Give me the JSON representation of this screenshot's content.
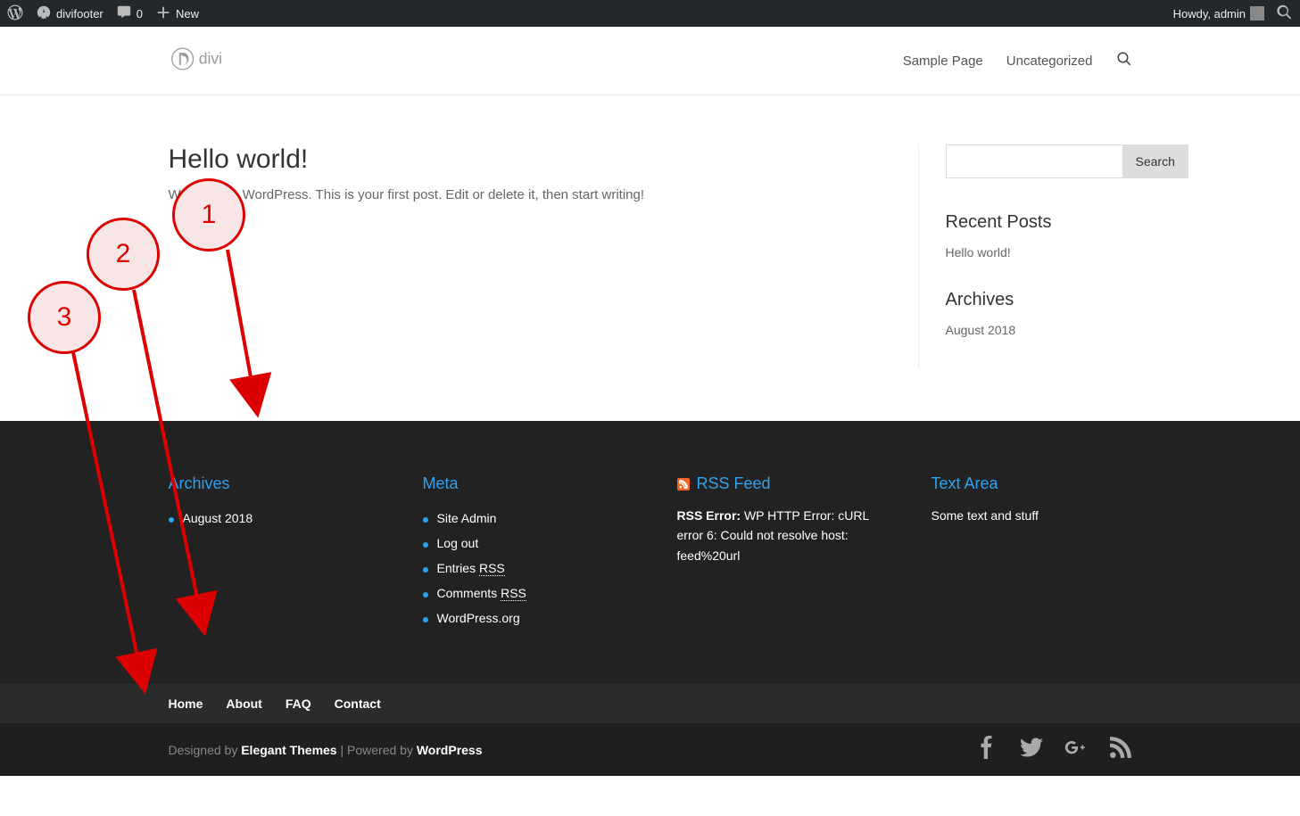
{
  "adminbar": {
    "site_name": "divifooter",
    "comments_count": "0",
    "new_label": "New",
    "howdy": "Howdy, admin"
  },
  "header": {
    "logo_text": "divi",
    "nav": [
      "Sample Page",
      "Uncategorized"
    ]
  },
  "post": {
    "title": "Hello world!",
    "body": "Welcome to WordPress. This is your first post. Edit or delete it, then start writing!"
  },
  "sidebar": {
    "search_button": "Search",
    "recent_heading": "Recent Posts",
    "recent_items": [
      "Hello world!"
    ],
    "archives_heading": "Archives",
    "archives_items": [
      "August 2018"
    ]
  },
  "footer_widgets": {
    "archives": {
      "heading": "Archives",
      "items": [
        "August 2018"
      ]
    },
    "meta": {
      "heading": "Meta",
      "item1": "Site Admin",
      "item2": "Log out",
      "item3_text": "Entries ",
      "item3_abbr": "RSS",
      "item4_text": "Comments ",
      "item4_abbr": "RSS",
      "item5": "WordPress.org"
    },
    "rss": {
      "heading": "RSS Feed",
      "error_label": "RSS Error:",
      "error_text": " WP HTTP Error: cURL error 6: Could not resolve host: feed%20url"
    },
    "text": {
      "heading": "Text Area",
      "content": "Some text and stuff"
    }
  },
  "footer_nav": [
    "Home",
    "About",
    "FAQ",
    "Contact"
  ],
  "credits": {
    "designed_by": "Designed by ",
    "designer": "Elegant Themes",
    "powered_by": " | Powered by ",
    "platform": "WordPress"
  },
  "annotations": {
    "c1": "1",
    "c2": "2",
    "c3": "3"
  }
}
